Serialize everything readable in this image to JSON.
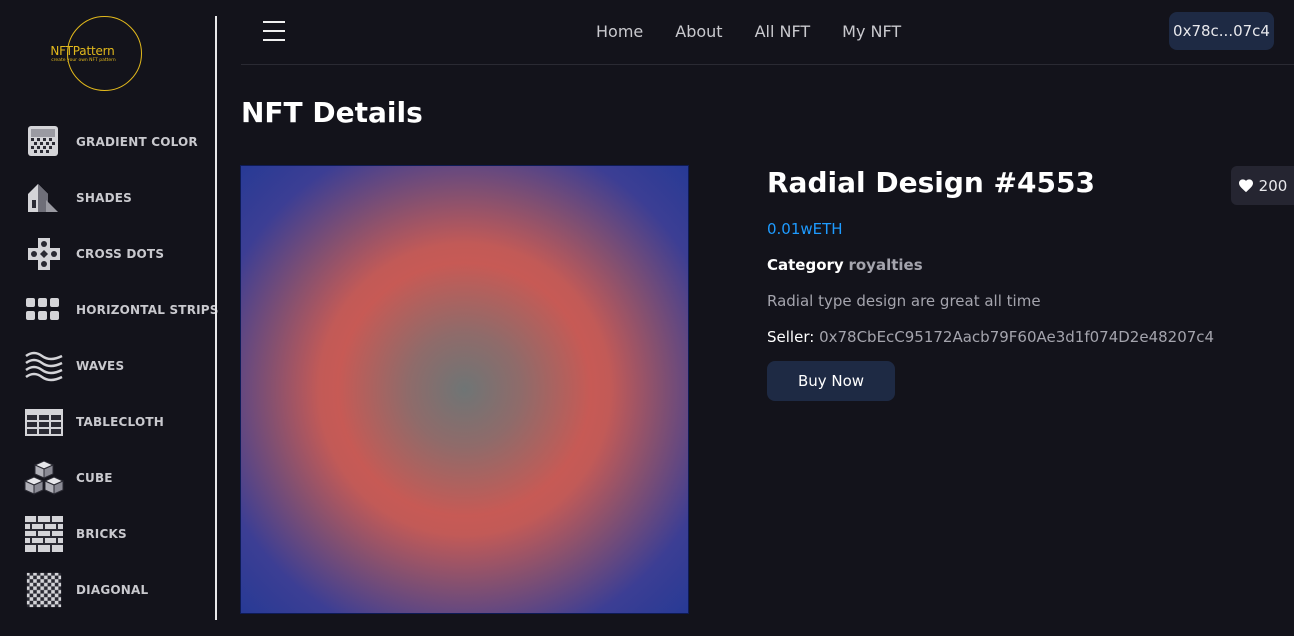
{
  "logo": {
    "name": "NFTPattern",
    "tagline": "create your own NFT pattern"
  },
  "sidebar": {
    "items": [
      {
        "label": "GRADIENT COLOR",
        "icon": "gradient-icon"
      },
      {
        "label": "SHADES",
        "icon": "shades-icon"
      },
      {
        "label": "CROSS DOTS",
        "icon": "cross-dots-icon"
      },
      {
        "label": "HORIZONTAL STRIPS",
        "icon": "horizontal-strips-icon"
      },
      {
        "label": "WAVES",
        "icon": "waves-icon"
      },
      {
        "label": "TABLECLOTH",
        "icon": "tablecloth-icon"
      },
      {
        "label": "CUBE",
        "icon": "cube-icon"
      },
      {
        "label": "BRICKS",
        "icon": "bricks-icon"
      },
      {
        "label": "DIAGONAL",
        "icon": "diagonal-icon"
      }
    ]
  },
  "nav": {
    "home": "Home",
    "about": "About",
    "all_nft": "All NFT",
    "my_nft": "My NFT"
  },
  "wallet": {
    "address": "0x78c...07c4"
  },
  "page": {
    "title": "NFT Details"
  },
  "nft": {
    "name": "Radial Design #4553",
    "likes": "200",
    "price": "0.01wETH",
    "category_label": "Category",
    "category": "royalties",
    "description": "Radial type design are great all time",
    "seller_label": "Seller:",
    "seller": "0x78CbEcC95172Aacb79F60Ae3d1f074D2e48207c4",
    "buy_label": "Buy Now"
  },
  "colors": {
    "background": "#13131b",
    "accent_gold": "#e2b91c",
    "price_blue": "#1e9bff",
    "button_bg": "#1e2a44"
  }
}
